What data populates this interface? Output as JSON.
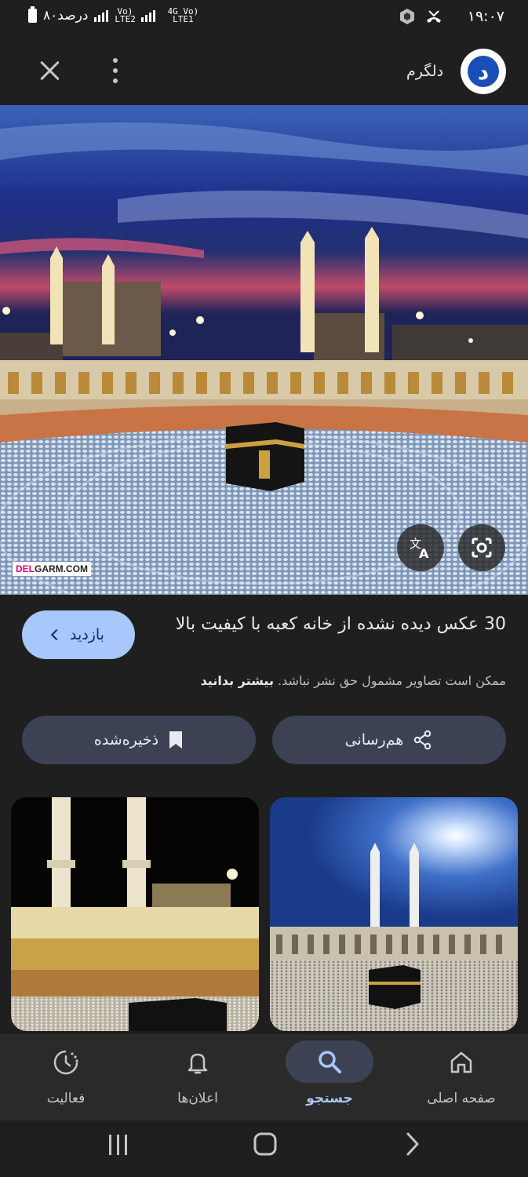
{
  "status_bar": {
    "time": "۱۹:۰۷",
    "battery": "۸۰درصد",
    "network_1": "Vo) LTE2",
    "network_2": "4G Vo) LTE1"
  },
  "header": {
    "site_name": "دلگرم",
    "logo_letter": "د"
  },
  "image": {
    "watermark_a": "DEL",
    "watermark_b": "GARM.COM"
  },
  "info": {
    "title": "30 عکس دیده نشده از خانه کعبه با کیفیت بالا",
    "copyright": "ممکن است تصاویر مشمول حق نشر نباشد.",
    "learn_more": "بیشتر بدانید",
    "visit_label": "بازدید"
  },
  "actions": {
    "share_label": "هم‌رسانی",
    "save_label": "ذخیره‌شده"
  },
  "bottom_nav": {
    "items": [
      {
        "label": "صفحه اصلی",
        "icon": "home-icon"
      },
      {
        "label": "جستجو",
        "icon": "search-icon",
        "active": true
      },
      {
        "label": "اعلان‌ها",
        "icon": "bell-icon"
      },
      {
        "label": "فعالیت",
        "icon": "activity-icon"
      }
    ]
  },
  "colors": {
    "background": "#1f1f1f",
    "accent": "#a8c7fa",
    "pill": "#3c4253"
  }
}
